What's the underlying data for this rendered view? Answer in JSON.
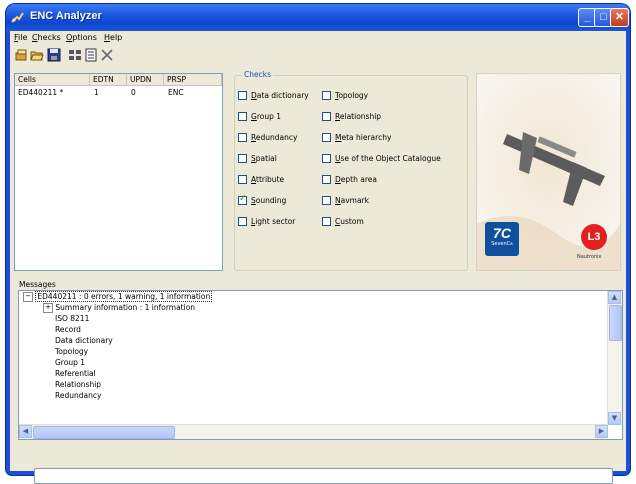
{
  "window": {
    "title": "ENC Analyzer"
  },
  "menu": [
    {
      "label": "File",
      "underline": "F",
      "rest": "ile"
    },
    {
      "label": "Checks",
      "underline": "C",
      "rest": "hecks"
    },
    {
      "label": "Options",
      "underline": "O",
      "rest": "ptions"
    },
    {
      "label": "Help",
      "underline": "H",
      "rest": "elp"
    }
  ],
  "toolbar": {
    "buttons": [
      {
        "icon": "open-cells-icon"
      },
      {
        "icon": "open-folder-icon"
      },
      {
        "icon": "save-icon"
      },
      {
        "icon": "run-checks-icon"
      },
      {
        "icon": "report-icon"
      },
      {
        "icon": "clear-icon"
      }
    ]
  },
  "cells_table": {
    "headers": [
      "Cells",
      "EDTN",
      "UPDN",
      "PRSP"
    ],
    "rows": [
      {
        "cell": "ED440211 *",
        "edtn": "1",
        "updn": "0",
        "prsp": "ENC"
      }
    ]
  },
  "checks": {
    "legend": "Checks",
    "left": [
      {
        "u": "D",
        "rest": "ata dictionary",
        "checked": false
      },
      {
        "u": "G",
        "rest": "roup 1",
        "checked": false
      },
      {
        "u": "R",
        "rest": "edundancy",
        "checked": false
      },
      {
        "u": "S",
        "rest": "patial",
        "checked": false
      },
      {
        "u": "A",
        "rest": "ttribute",
        "checked": false
      },
      {
        "u": "S",
        "rest": "ounding",
        "checked": true
      },
      {
        "u": "L",
        "rest": "ight sector",
        "checked": false
      }
    ],
    "right": [
      {
        "u": "T",
        "rest": "opology",
        "checked": false
      },
      {
        "u": "R",
        "rest": "elationship",
        "checked": false
      },
      {
        "u": "M",
        "rest": "eta hierarchy",
        "checked": false
      },
      {
        "u": "U",
        "rest": "se of the Object Catalogue",
        "checked": false
      },
      {
        "u": "D",
        "rest": "epth area",
        "checked": false
      },
      {
        "u": "N",
        "rest": "avmark",
        "checked": false
      },
      {
        "u": "C",
        "rest": "ustom",
        "checked": false
      }
    ]
  },
  "logo": {
    "badge_left": "7C",
    "badge_left_sub": "SevenCs",
    "badge_right": "L3",
    "badge_right_sub": "Nautronix"
  },
  "messages": {
    "label": "Messages",
    "root": "ED440211 : 0 errors, 1 warning, 1 information",
    "summary": "Summary information : 1 information",
    "items": [
      "ISO 8211",
      "Record",
      "Data dictionary",
      "Topology",
      "Group 1",
      "Referential",
      "Relationship",
      "Redundancy"
    ]
  },
  "status_bar": {
    "text": ""
  },
  "colors": {
    "title_blue": "#1f5ce6",
    "window_bg": "#ece9d8",
    "check_green": "#21a121"
  }
}
